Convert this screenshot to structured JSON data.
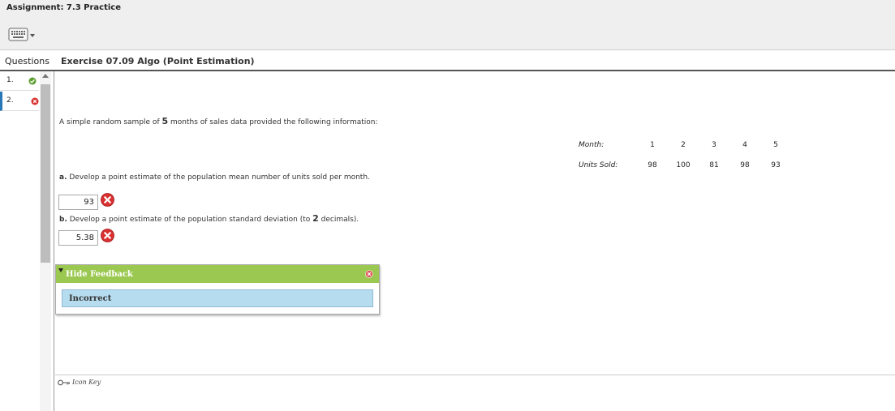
{
  "assignment": {
    "title": "Assignment: 7.3 Practice"
  },
  "toolbar": {
    "keyboard_icon": "keyboard-icon"
  },
  "questions": {
    "header": "Questions",
    "items": [
      {
        "label": "1.",
        "status": "correct"
      },
      {
        "label": "2.",
        "status": "incorrect"
      }
    ]
  },
  "exercise": {
    "title": "Exercise 07.09 Algo (Point Estimation)",
    "prompt_before": "A simple random sample of ",
    "sample_n": "5",
    "prompt_after": " months of sales data provided the following information:",
    "table": {
      "row1_label": "Month:",
      "row1": [
        "1",
        "2",
        "3",
        "4",
        "5"
      ],
      "row2_label": "Units Sold:",
      "row2": [
        "98",
        "100",
        "81",
        "98",
        "93"
      ]
    },
    "part_a": {
      "letter": "a.",
      "text": " Develop a point estimate of the population mean number of units sold per month.",
      "answer": "93"
    },
    "part_b": {
      "letter": "b.",
      "text_before": " Develop a point estimate of the population standard deviation (to ",
      "decimals": "2",
      "text_after": " decimals).",
      "answer": "5.38"
    }
  },
  "feedback": {
    "toggle_label": "Hide Feedback",
    "message": "Incorrect"
  },
  "footer": {
    "icon_key_label": "Icon Key"
  },
  "colors": {
    "feedback_header": "#9bc850",
    "feedback_body": "#b6dcef",
    "correct": "#5c9e31",
    "incorrect": "#d93030",
    "active_marker": "#2a77b7"
  }
}
